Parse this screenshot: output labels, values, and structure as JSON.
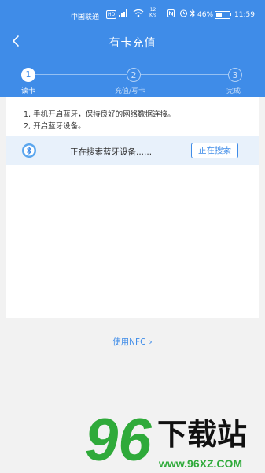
{
  "status_bar": {
    "carrier": "中国联通",
    "hd": "HD",
    "speed_value": "12",
    "speed_unit": "K/s",
    "battery_pct": "46%",
    "battery_level": 0.46,
    "time": "11:59"
  },
  "nav": {
    "title": "有卡充值"
  },
  "steps": [
    {
      "number": "1",
      "label": "读卡"
    },
    {
      "number": "2",
      "label": "充值/写卡"
    },
    {
      "number": "3",
      "label": "完成"
    }
  ],
  "instructions": [
    "1, 手机开启蓝牙，保持良好的网络数据连接。",
    "2, 开启蓝牙设备。"
  ],
  "search": {
    "status_text": "正在搜索蓝牙设备......",
    "button_label": "正在搜索"
  },
  "nfc": {
    "label": "使用NFC"
  },
  "watermark": {
    "logo_number": "96",
    "logo_text": "下载站",
    "url": "www.96XZ.COM"
  },
  "colors": {
    "primary": "#3f8ce8",
    "search_row_bg": "#e8f1fb",
    "watermark_green": "#2faa3a"
  }
}
